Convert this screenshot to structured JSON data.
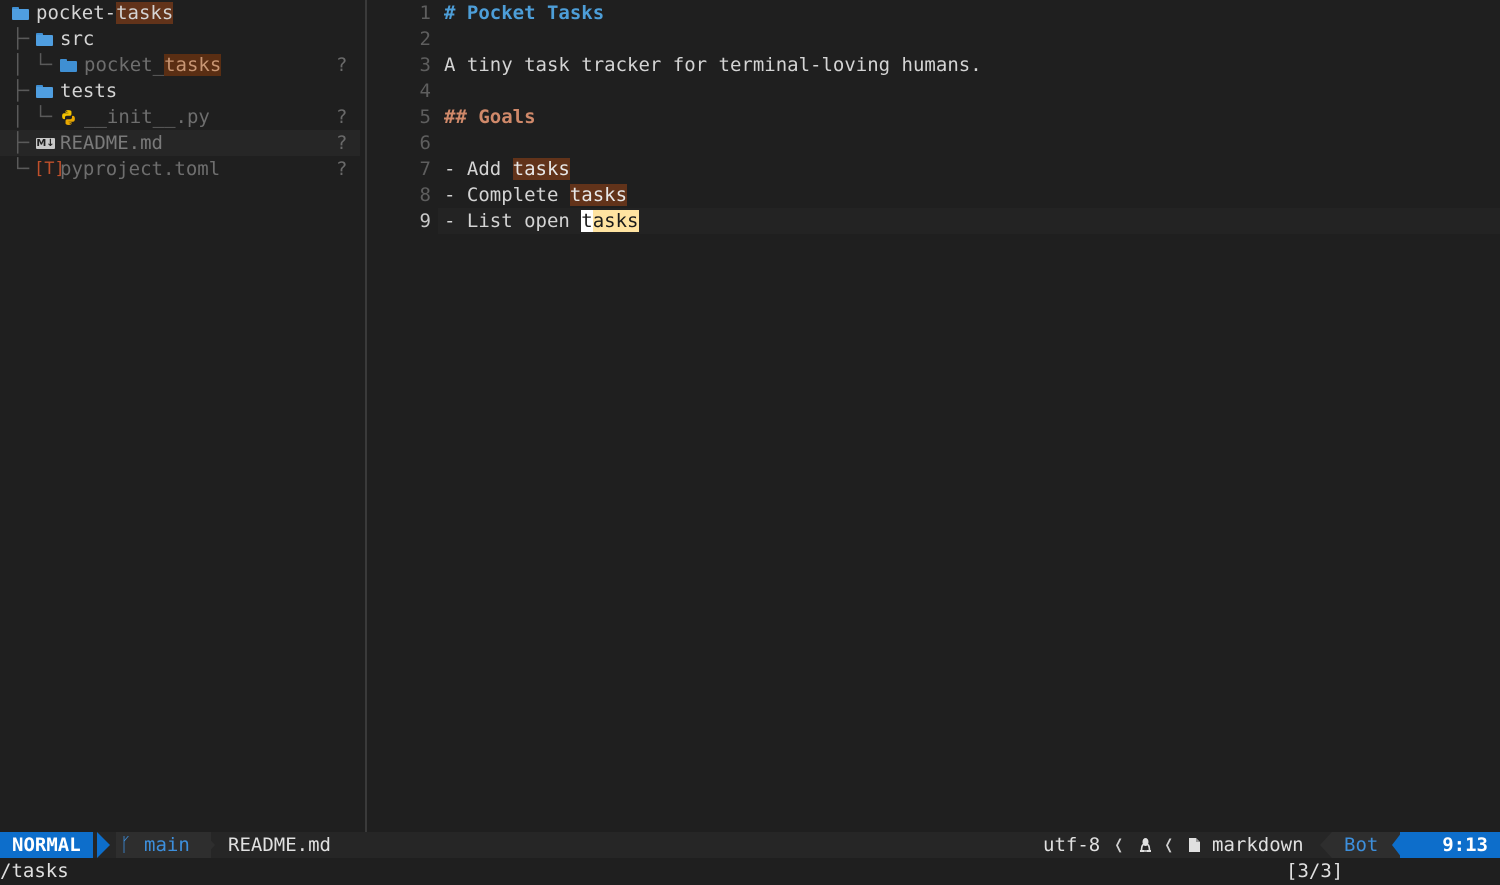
{
  "explorer": {
    "root": {
      "prefix": "pocket-",
      "match": "tasks"
    },
    "items": [
      {
        "name": "src",
        "kind": "folder"
      },
      {
        "name_prefix": "pocket_",
        "name_match": "tasks",
        "kind": "folder",
        "status": "?"
      },
      {
        "name": "tests",
        "kind": "folder"
      },
      {
        "name": "__init__.py",
        "kind": "python",
        "status": "?"
      },
      {
        "name": "README.md",
        "kind": "markdown",
        "status": "?"
      },
      {
        "name": "pyproject.toml",
        "kind": "toml",
        "status": "?"
      }
    ],
    "md_icon_text": "M↓",
    "toml_icon_text": "[T]"
  },
  "editor": {
    "line_numbers": [
      "1",
      "2",
      "3",
      "4",
      "5",
      "6",
      "7",
      "8",
      "9"
    ],
    "lines": {
      "l1": "# Pocket Tasks",
      "l3": "A tiny task tracker for terminal-loving humans.",
      "l5": "## Goals",
      "l7_prefix": "- Add ",
      "l7_match": "tasks",
      "l8_prefix": "- Complete ",
      "l8_match": "tasks",
      "l9_prefix": "- List open ",
      "l9_cursor": "t",
      "l9_match_rest": "asks"
    }
  },
  "statusline": {
    "mode": "NORMAL",
    "branch_icon": "ᚴ",
    "branch": "main",
    "file": "README.md",
    "encoding": "utf-8",
    "os_icon": "linux-icon",
    "file_icon": "file-icon",
    "filetype": "markdown",
    "scroll": "Bot",
    "position": "9:13"
  },
  "cmdline": {
    "command": "/tasks",
    "search_count": "[3/3]"
  },
  "colors": {
    "mode_bg": "#0d6ecb",
    "match_bg": "#62331a",
    "current_match_bg": "#ffe3a1",
    "heading1": "#4d9ed8",
    "heading2": "#d0896a"
  }
}
